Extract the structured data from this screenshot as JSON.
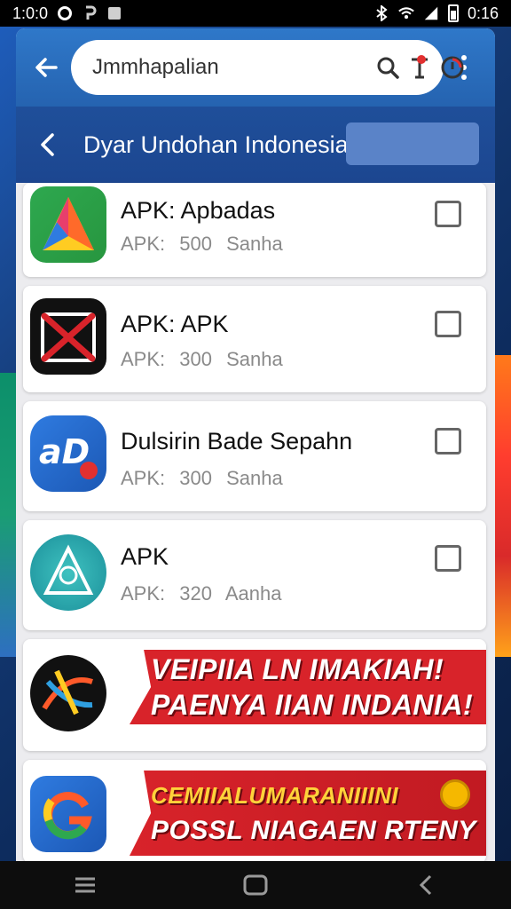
{
  "status_bar": {
    "left_time": "1:0:0",
    "right_time": "0:16"
  },
  "search_header": {
    "query": "Jmmhapalian"
  },
  "sub_header": {
    "title": "Dyar Undohan Indonesia"
  },
  "apps": [
    {
      "title": "APK: Apbadas",
      "meta": "APK: 500 Sanha"
    },
    {
      "title": "APK: APK",
      "meta": "APK: 300 Sanha"
    },
    {
      "title": "Dulsirin Bade Sepahn",
      "meta": "APK: 300 Sanha"
    },
    {
      "title": "APK",
      "meta": "APK: 320 Aanha"
    }
  ],
  "banners": [
    {
      "line1": "VEIPIIA LN IMAKIAH!",
      "line2": "PAENYA IIAN INDANIA!"
    },
    {
      "line1": "CEMIIALUMARANIIINI",
      "line2": "POSSL NIAGAEN RTENY"
    }
  ],
  "colors": {
    "header_blue": "#2f78c9",
    "subheader_blue": "#1f4f9a",
    "banner_red": "#d8232a",
    "banner_yellow": "#ffd23a"
  },
  "icons": [
    "arrow-back-icon",
    "search-icon",
    "share-icon",
    "record-icon",
    "more-vert-icon",
    "menu-icon",
    "home-icon",
    "back-icon"
  ]
}
